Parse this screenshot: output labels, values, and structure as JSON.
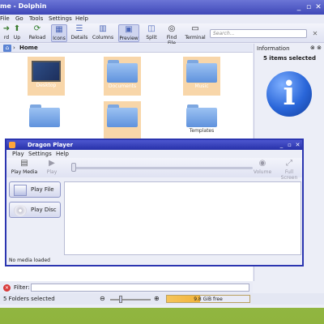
{
  "dolphin": {
    "title": "me - Dolphin",
    "menu": [
      "File",
      "Go",
      "Tools",
      "Settings",
      "Help"
    ],
    "toolbar": [
      {
        "label": "rd",
        "icon": "forward-icon"
      },
      {
        "label": "Up",
        "icon": "up-arrow-icon"
      },
      {
        "label": "Reload",
        "icon": "reload-icon"
      },
      {
        "label": "Icons",
        "icon": "icons-view-icon"
      },
      {
        "label": "Details",
        "icon": "details-view-icon"
      },
      {
        "label": "Columns",
        "icon": "columns-view-icon"
      },
      {
        "label": "Preview",
        "icon": "preview-icon"
      },
      {
        "label": "Split",
        "icon": "split-icon"
      },
      {
        "label": "Find File",
        "icon": "binoculars-icon"
      },
      {
        "label": "Terminal",
        "icon": "terminal-icon"
      }
    ],
    "search_placeholder": "Search...",
    "location": "Home",
    "files": [
      {
        "name": "Desktop",
        "selected": true
      },
      {
        "name": "Documents",
        "selected": true
      },
      {
        "name": "Music",
        "selected": true
      },
      {
        "name": "",
        "selected": false
      },
      {
        "name": "",
        "selected": true
      },
      {
        "name": "Templates",
        "selected": false
      }
    ],
    "info": {
      "header": "Information",
      "selection": "5 items selected"
    },
    "filter_label": "Filter:",
    "status": "5 Folders selected",
    "free_space": "9.8 GiB free"
  },
  "dragon": {
    "title": "Dragon Player",
    "menu": [
      "Play",
      "Settings",
      "Help"
    ],
    "toolbar": {
      "play_media": "Play Media",
      "play": "Play",
      "volume": "Volume",
      "fullscreen": "Full Screen"
    },
    "buttons": {
      "play_file": "Play File",
      "play_disc": "Play Disc"
    },
    "status": "No media loaded"
  }
}
